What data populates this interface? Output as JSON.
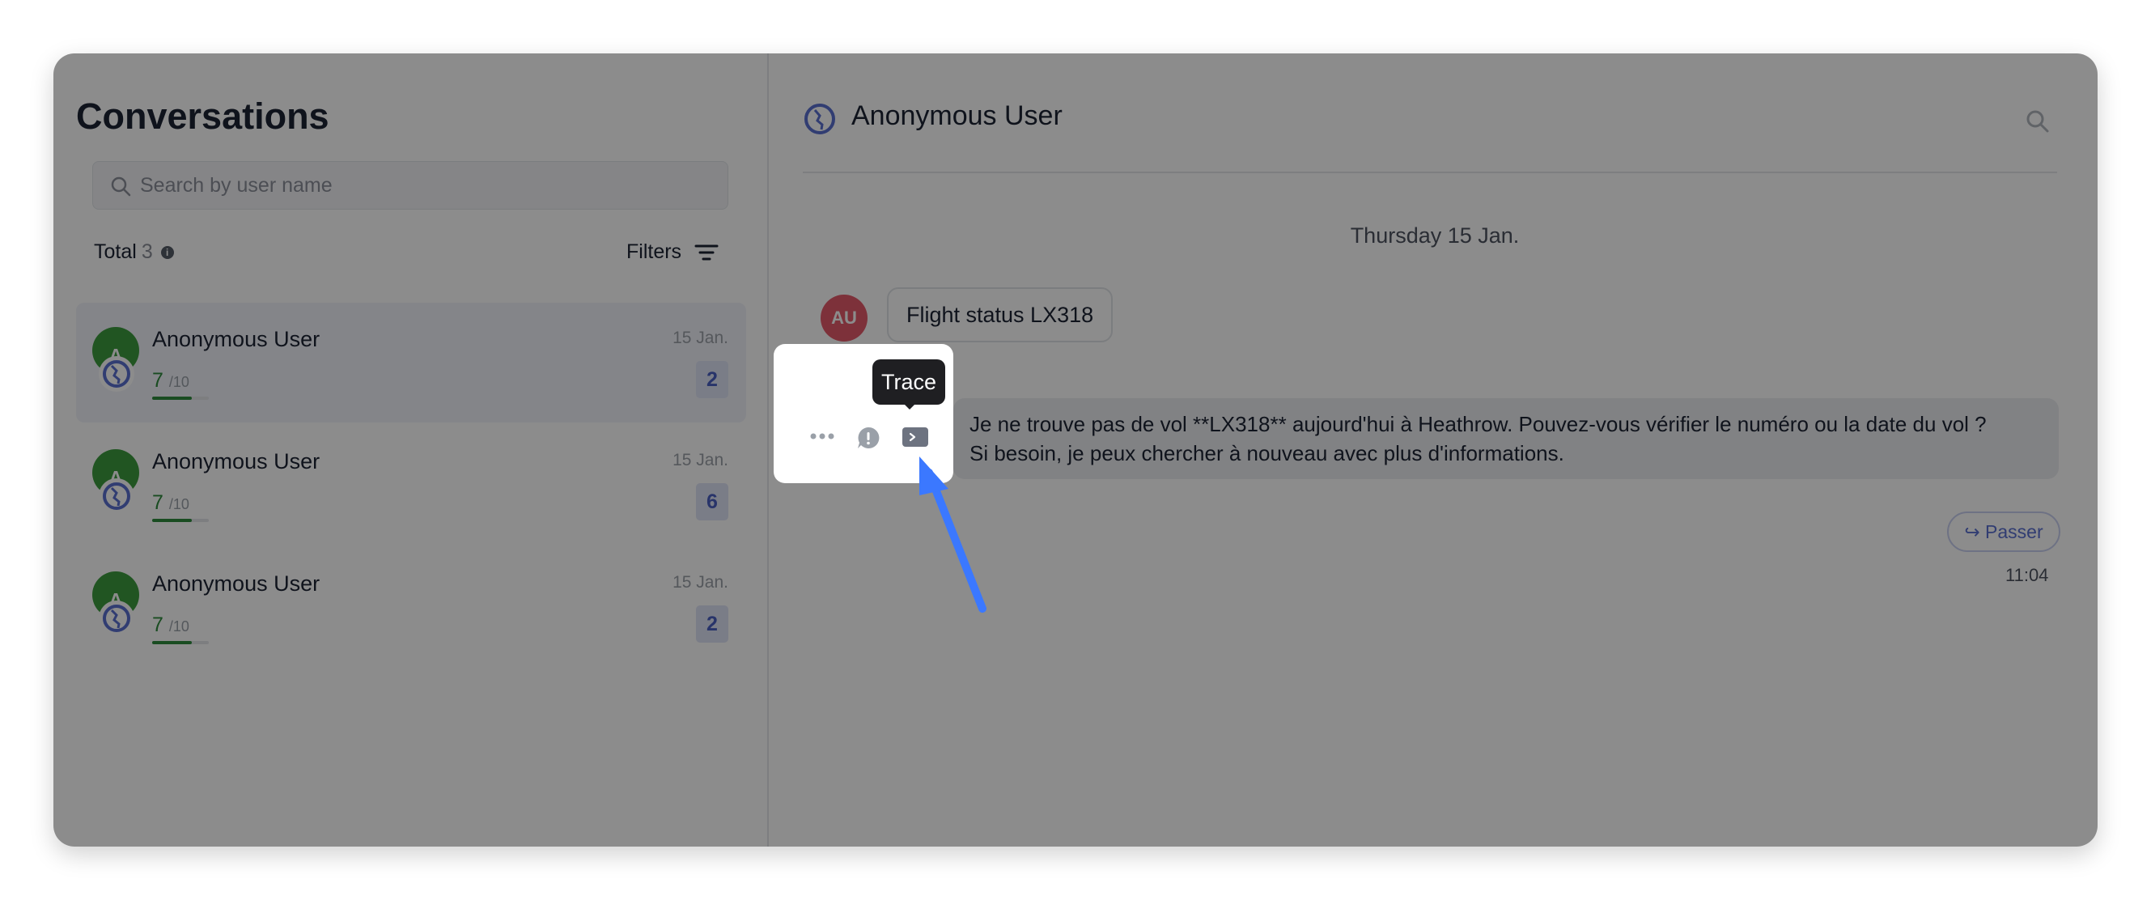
{
  "left": {
    "title": "Conversations",
    "search_placeholder": "Search by user name",
    "total_label": "Total",
    "total_count": "3",
    "info_glyph": "i",
    "filters_label": "Filters",
    "items": [
      {
        "avatar": "A",
        "name": "Anonymous User",
        "score": "7",
        "score_den": "/10",
        "score_fraction": 0.7,
        "date": "15 Jan.",
        "badge": "2"
      },
      {
        "avatar": "A",
        "name": "Anonymous User",
        "score": "7",
        "score_den": "/10",
        "score_fraction": 0.7,
        "date": "15 Jan.",
        "badge": "6"
      },
      {
        "avatar": "A",
        "name": "Anonymous User",
        "score": "7",
        "score_den": "/10",
        "score_fraction": 0.7,
        "date": "15 Jan.",
        "badge": "2"
      }
    ]
  },
  "chat": {
    "title": "Anonymous User",
    "date_separator": "Thursday 15 Jan.",
    "user_avatar": "AU",
    "user_message": "Flight status LX318",
    "bot_message_line1": "Je ne trouve pas de vol **LX318** aujourd'hui à Heathrow. Pouvez-vous vérifier le numéro ou la date du vol ?",
    "bot_message_line2": "Si besoin, je peux chercher à nouveau avec plus d'informations.",
    "skip_label": "↪ Passer",
    "time": "11:04"
  },
  "popup": {
    "tooltip": "Trace"
  },
  "colors": {
    "accent": "#5a6fd0",
    "score_green": "#2e8b3d",
    "user_avatar": "#e45a6a",
    "conv_avatar": "#3d9b3f",
    "arrow": "#3b78ff"
  }
}
